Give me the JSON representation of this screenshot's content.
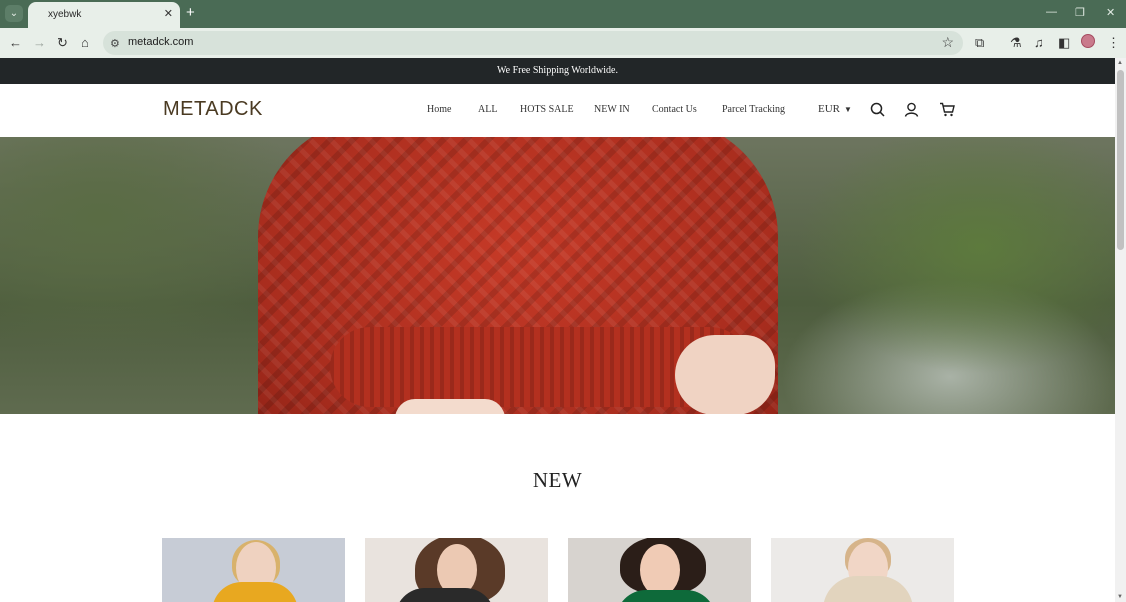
{
  "browser": {
    "tab_title": "xyebwk",
    "url": "metadck.com",
    "tab_list_icon": "chevron-down-icon",
    "controls": [
      "minimize",
      "restore",
      "close"
    ]
  },
  "announcement": "We Free Shipping Worldwide.",
  "header": {
    "logo": "METADCK",
    "nav": [
      "Home",
      "ALL",
      "HOTS SALE",
      "NEW IN",
      "Contact Us",
      "Parcel Tracking"
    ],
    "currency": "EUR"
  },
  "main": {
    "section_title": "NEW"
  },
  "colors": {
    "chrome": "#4a6b55",
    "toolbar": "#e8efe9",
    "announce_bar": "#222628",
    "logo": "#4a3a22"
  }
}
